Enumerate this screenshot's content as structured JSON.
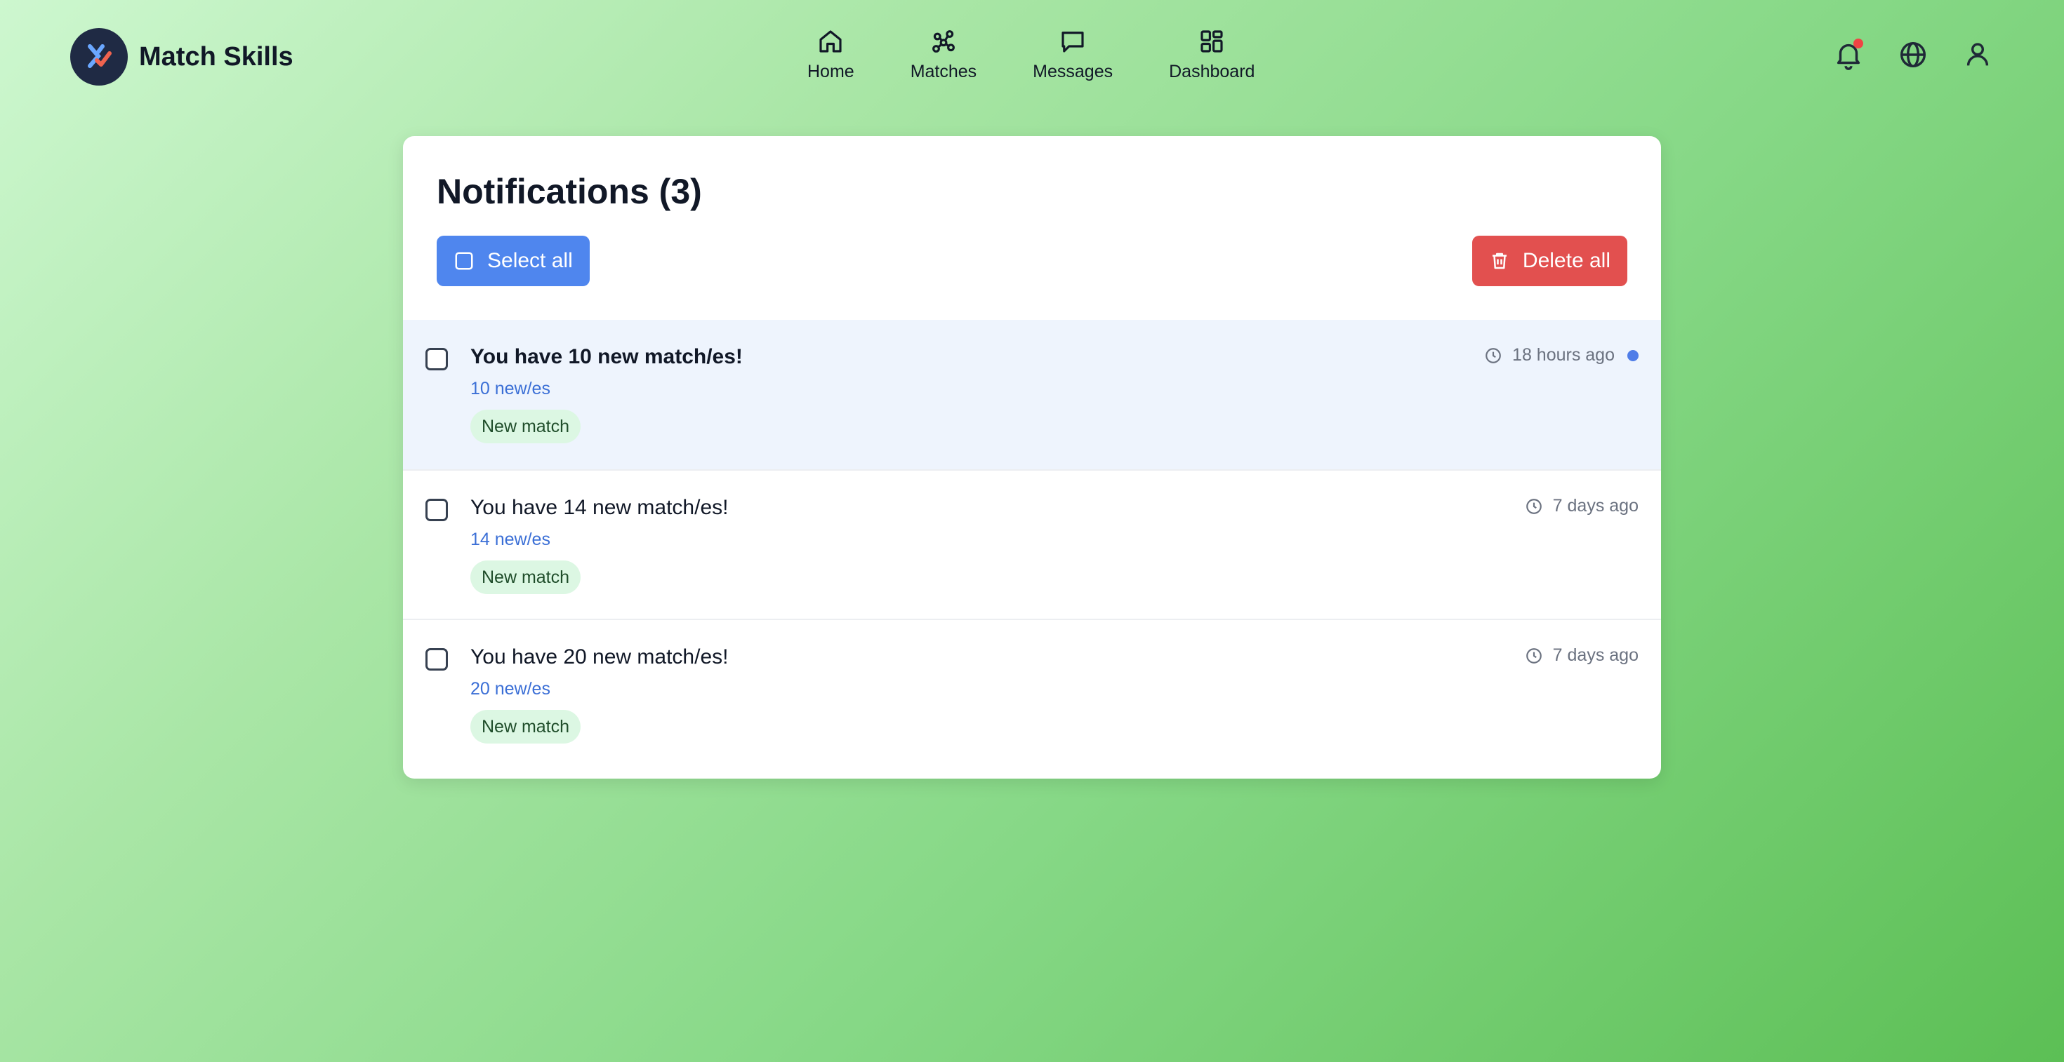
{
  "brand": {
    "name": "Match Skills",
    "logo_icon": "match-skills-logo"
  },
  "nav": {
    "items": [
      {
        "label": "Home",
        "icon": "home-icon"
      },
      {
        "label": "Matches",
        "icon": "network-icon"
      },
      {
        "label": "Messages",
        "icon": "message-icon"
      },
      {
        "label": "Dashboard",
        "icon": "dashboard-icon"
      }
    ]
  },
  "header_icons": [
    "bell-icon",
    "globe-icon",
    "user-icon"
  ],
  "card": {
    "title": "Notifications (3)",
    "select_all_label": "Select all",
    "delete_all_label": "Delete all"
  },
  "notifications": [
    {
      "title": "You have 10 new match/es!",
      "subtitle": "10 new/es",
      "tag": "New match",
      "time": "18 hours ago",
      "unread": true
    },
    {
      "title": "You have 14 new match/es!",
      "subtitle": "14 new/es",
      "tag": "New match",
      "time": "7 days ago",
      "unread": false
    },
    {
      "title": "You have 20 new match/es!",
      "subtitle": "20 new/es",
      "tag": "New match",
      "time": "7 days ago",
      "unread": false
    }
  ],
  "colors": {
    "primary": "#4f86ee",
    "danger": "#e2504f",
    "unread_bg": "#eef4fd",
    "tag_bg": "#dcf7e3",
    "link": "#3b6fd6"
  }
}
